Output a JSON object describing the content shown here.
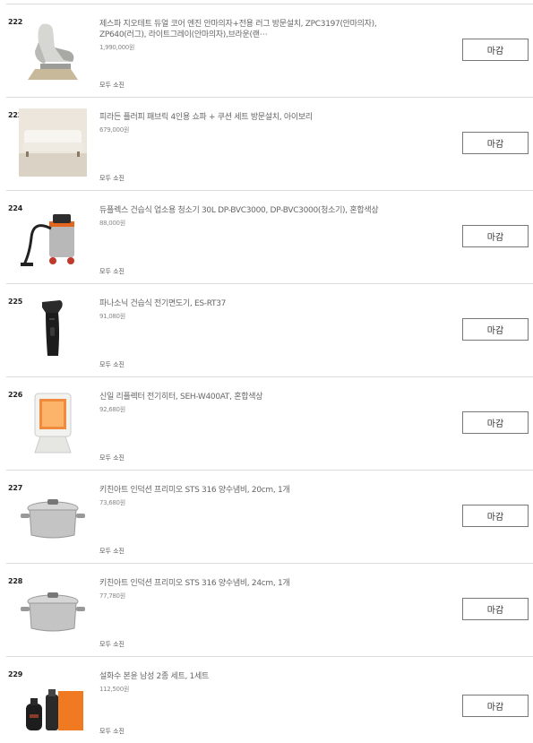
{
  "items": [
    {
      "num": "222",
      "title": "제스파 지오테트 듀얼 코어 엔진 안마의자+전용 러그 방문설치, ZPC3197(안마의자), ZP640(러그), 라이트그레이(안마의자),브라운(랜⋯",
      "price": "1,990,000원",
      "status": "모두 소진",
      "button": "마감",
      "icon": "massage-chair-icon"
    },
    {
      "num": "223",
      "title": "피라든 플러피 패브릭 4인용 쇼파 + 쿠션 세트 방문설치, 아이보리",
      "price": "679,000원",
      "status": "모두 소진",
      "button": "마감",
      "icon": "sofa-icon"
    },
    {
      "num": "224",
      "title": "듀플렉스 건습식 업소용 청소기 30L DP-BVC3000, DP-BVC3000(청소기), 혼합색상",
      "price": "88,000원",
      "status": "모두 소진",
      "button": "마감",
      "icon": "vacuum-cleaner-icon"
    },
    {
      "num": "225",
      "title": "파나소닉 건습식 전기면도기, ES-RT37",
      "price": "91,080원",
      "status": "모두 소진",
      "button": "마감",
      "icon": "electric-shaver-icon"
    },
    {
      "num": "226",
      "title": "신일 리플렉터 전기히터, SEH-W400AT, 혼합색상",
      "price": "92,680원",
      "status": "모두 소진",
      "button": "마감",
      "icon": "electric-heater-icon"
    },
    {
      "num": "227",
      "title": "키친아트 인덕션 프리미오 STS 316 양수냄비, 20cm, 1개",
      "price": "73,680원",
      "status": "모두 소진",
      "button": "마감",
      "icon": "pot-icon"
    },
    {
      "num": "228",
      "title": "키친아트 인덕션 프리미오 STS 316 양수냄비, 24cm, 1개",
      "price": "77,780원",
      "status": "모두 소진",
      "button": "마감",
      "icon": "pot-icon"
    },
    {
      "num": "229",
      "title": "설화수 본윤 남성 2종 세트, 1세트",
      "price": "112,500원",
      "status": "모두 소진",
      "button": "마감",
      "icon": "cosmetics-set-icon"
    }
  ]
}
